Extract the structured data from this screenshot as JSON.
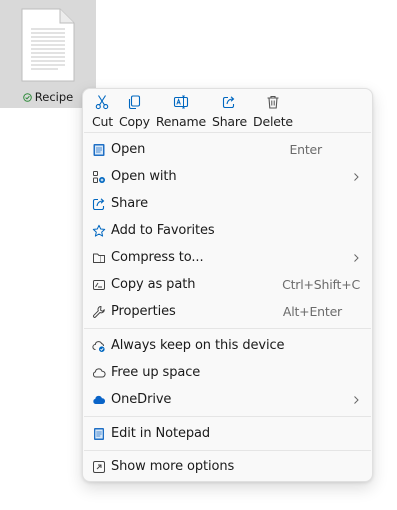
{
  "file": {
    "name": "Recipe",
    "status": "synced"
  },
  "quick_actions": [
    {
      "label": "Cut",
      "icon": "scissors-icon"
    },
    {
      "label": "Copy",
      "icon": "copy-icon"
    },
    {
      "label": "Rename",
      "icon": "rename-icon"
    },
    {
      "label": "Share",
      "icon": "share-icon"
    },
    {
      "label": "Delete",
      "icon": "trash-icon"
    }
  ],
  "menu": {
    "open": {
      "label": "Open",
      "shortcut": "Enter"
    },
    "open_with": {
      "label": "Open with"
    },
    "share": {
      "label": "Share"
    },
    "favorites": {
      "label": "Add to Favorites"
    },
    "compress": {
      "label": "Compress to..."
    },
    "copy_path": {
      "label": "Copy as path",
      "shortcut": "Ctrl+Shift+C"
    },
    "properties": {
      "label": "Properties",
      "shortcut": "Alt+Enter"
    },
    "keep_on_device": {
      "label": "Always keep on this device"
    },
    "free_space": {
      "label": "Free up space"
    },
    "onedrive": {
      "label": "OneDrive"
    },
    "notepad": {
      "label": "Edit in Notepad"
    },
    "more_options": {
      "label": "Show more options"
    }
  },
  "colors": {
    "accent": "#0067c0",
    "onedrive_blue": "#0a64c8",
    "sync_green": "#2e8b3a",
    "menu_bg": "#f9f9f9",
    "selection_bg": "#d9d9d9"
  }
}
